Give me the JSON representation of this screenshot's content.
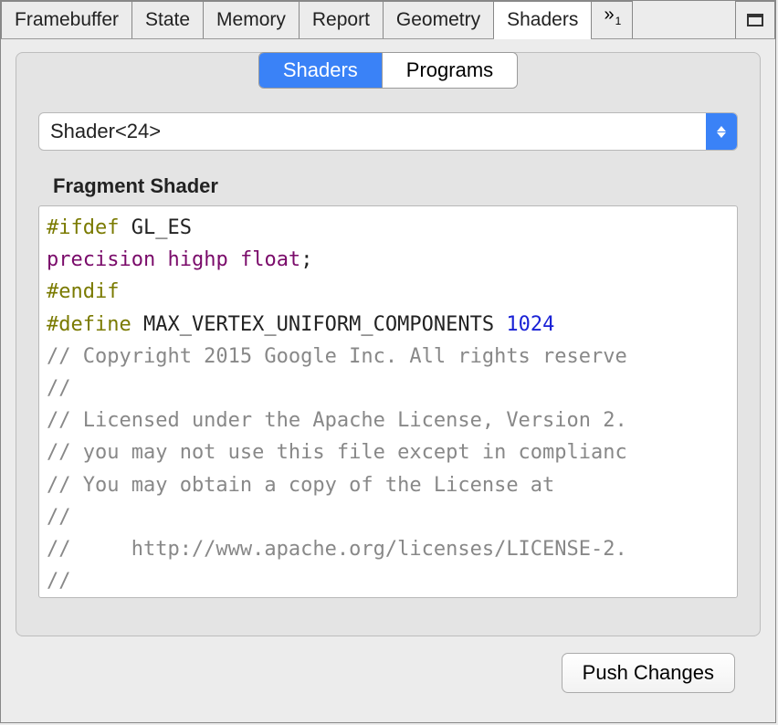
{
  "tabs": {
    "items": [
      {
        "label": "Framebuffer"
      },
      {
        "label": "State"
      },
      {
        "label": "Memory"
      },
      {
        "label": "Report"
      },
      {
        "label": "Geometry"
      },
      {
        "label": "Shaders"
      }
    ],
    "active_index": 5,
    "overflow_glyph": "»",
    "overflow_sub": "1"
  },
  "segmented": {
    "items": [
      {
        "label": "Shaders"
      },
      {
        "label": "Programs"
      }
    ],
    "active_index": 0
  },
  "dropdown": {
    "selected": "Shader<24>"
  },
  "section_title": "Fragment Shader",
  "code": {
    "lines": [
      {
        "frags": [
          {
            "t": "#ifdef",
            "c": "pp"
          },
          {
            "t": " "
          },
          {
            "t": "GL_ES",
            "c": "plain"
          }
        ]
      },
      {
        "frags": [
          {
            "t": "precision",
            "c": "kw"
          },
          {
            "t": " "
          },
          {
            "t": "highp",
            "c": "kw"
          },
          {
            "t": " "
          },
          {
            "t": "float",
            "c": "kw"
          },
          {
            "t": ";",
            "c": "plain"
          }
        ]
      },
      {
        "frags": [
          {
            "t": "#endif",
            "c": "pp"
          }
        ]
      },
      {
        "frags": [
          {
            "t": "#define",
            "c": "pp"
          },
          {
            "t": " "
          },
          {
            "t": "MAX_VERTEX_UNIFORM_COMPONENTS",
            "c": "plain"
          },
          {
            "t": " "
          },
          {
            "t": "1024",
            "c": "num"
          }
        ]
      },
      {
        "frags": [
          {
            "t": "// Copyright 2015 Google Inc. All rights reserve",
            "c": "cm"
          }
        ]
      },
      {
        "frags": [
          {
            "t": "//",
            "c": "cm"
          }
        ]
      },
      {
        "frags": [
          {
            "t": "// Licensed under the Apache License, Version 2.",
            "c": "cm"
          }
        ]
      },
      {
        "frags": [
          {
            "t": "// you may not use this file except in complianc",
            "c": "cm"
          }
        ]
      },
      {
        "frags": [
          {
            "t": "// You may obtain a copy of the License at",
            "c": "cm"
          }
        ]
      },
      {
        "frags": [
          {
            "t": "//",
            "c": "cm"
          }
        ]
      },
      {
        "frags": [
          {
            "t": "//     http://www.apache.org/licenses/LICENSE-2.",
            "c": "cm"
          }
        ]
      },
      {
        "frags": [
          {
            "t": "//",
            "c": "cm"
          }
        ]
      }
    ]
  },
  "push_button": "Push Changes"
}
